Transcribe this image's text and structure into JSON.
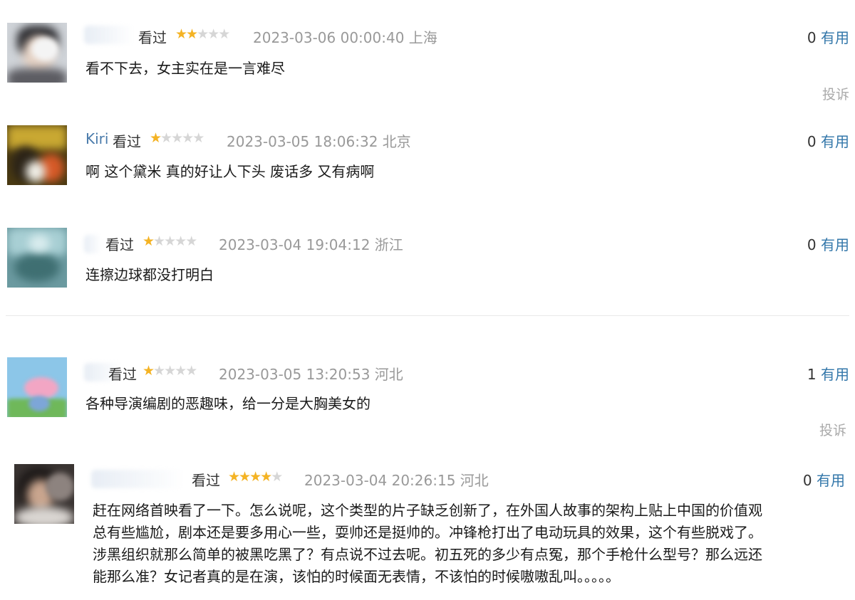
{
  "reviews": [
    {
      "username": "",
      "watched": "看过",
      "rating": 2,
      "time": "2023-03-06 00:00:40 上海",
      "useful_count": "0",
      "useful_label": "有用",
      "content": "看不下去，女主实在是一言难尽",
      "report": "投诉"
    },
    {
      "username": "Kiri",
      "watched": "看过",
      "rating": 1,
      "time": "2023-03-05 18:06:32 北京",
      "useful_count": "0",
      "useful_label": "有用",
      "content": "啊 这个黛米 真的好让人下头 废话多 又有病啊",
      "report": ""
    },
    {
      "username": "",
      "watched": "看过",
      "rating": 1,
      "time": "2023-03-04 19:04:12 浙江",
      "useful_count": "0",
      "useful_label": "有用",
      "content": "连擦边球都没打明白",
      "report": ""
    },
    {
      "username": "",
      "watched": "看过",
      "rating": 1,
      "time": "2023-03-05 13:20:53 河北",
      "useful_count": "1",
      "useful_label": "有用",
      "content": "各种导演编剧的恶趣味，给一分是大胸美女的",
      "report": "投诉"
    },
    {
      "username": "",
      "watched": "看过",
      "rating": 4,
      "time": "2023-03-04 20:26:15 河北",
      "useful_count": "0",
      "useful_label": "有用",
      "content_lines": [
        "赶在网络首映看了一下。怎么说呢，这个类型的片子缺乏创新了，在外国人故事的架构上贴上中国的价值观",
        "总有些尴尬，剧本还是要多用心一些，耍帅还是挺帅的。冲锋枪打出了电动玩具的效果，这个有些脱戏了。",
        "涉黑组织就那么简单的被黑吃黑了？有点说不过去呢。初五死的多少有点冤，那个手枪什么型号？那么远还",
        "能那么准？女记者真的是在演，该怕的时候面无表情，不该怕的时候嗷嗷乱叫。。。。。"
      ],
      "report": ""
    }
  ],
  "colors": {
    "star_on": "#f4b324",
    "star_off": "#d6d6d6",
    "link": "#3377aa",
    "time": "#999999"
  }
}
